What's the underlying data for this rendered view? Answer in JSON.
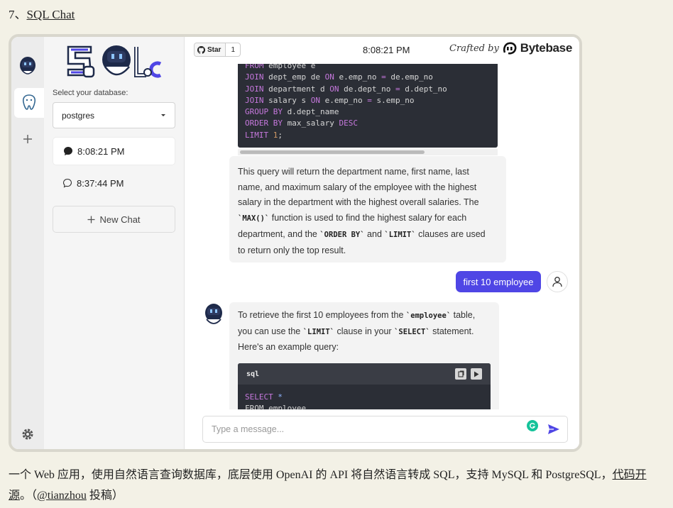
{
  "heading": {
    "number": "7、",
    "link": "SQL Chat"
  },
  "sidebar": {
    "db_label": "Select your database:",
    "db_selected": "postgres",
    "chats": [
      {
        "label": "8:08:21 PM",
        "active": true
      },
      {
        "label": "8:37:44 PM",
        "active": false
      }
    ],
    "new_chat": "New Chat"
  },
  "topbar": {
    "star_label": "Star",
    "star_count": "1",
    "clock": "8:08:21 PM",
    "crafted_by": "Crafted by",
    "brand": "Bytebase"
  },
  "code_top": [
    "FROM employee e",
    "JOIN dept_emp de ON e.emp_no = de.emp_no",
    "JOIN department d ON de.dept_no = d.dept_no",
    "JOIN salary s ON e.emp_no = s.emp_no",
    "GROUP BY d.dept_name",
    "ORDER BY max_salary DESC",
    "LIMIT 1;"
  ],
  "answer1": {
    "l1": "This query will return the department name, first name, last",
    "l2": "name, and maximum salary of the employee with the highest",
    "l3": "salary in the department with the highest overall salaries. The",
    "l4a": "`MAX()`",
    "l4b": " function is used to find the highest salary for each",
    "l5a": "department, and the ",
    "l5b": "`ORDER BY`",
    "l5c": " and ",
    "l5d": "`LIMIT`",
    "l5e": " clauses are used",
    "l6": "to return only the top result."
  },
  "user_message": "first 10 employee",
  "answer2": {
    "l1a": "To retrieve the first 10 employees from the ",
    "l1b": "`employee`",
    "l1c": " table,",
    "l2a": "you can use the ",
    "l2b": "`LIMIT`",
    "l2c": " clause in your ",
    "l2d": "`SELECT`",
    "l2e": " statement.",
    "l3": "Here's an example query:"
  },
  "code_block2": {
    "lang": "sql",
    "line1_kw": "SELECT",
    "line1_rest": " *",
    "line2": "FROM employee"
  },
  "input": {
    "placeholder": "Type a message..."
  },
  "caption": {
    "part1": "一个 Web 应用，使用自然语言查询数据库，底层使用 OpenAI 的 API 将自然语言转成 SQL，支持 MySQL 和 PostgreSQL，",
    "link1": "代码开源",
    "part2": "。（",
    "link2": "@tianzhou",
    "part3": " 投稿）"
  },
  "colors": {
    "accent": "#4f46e5",
    "code_bg": "#2b2e36",
    "page_bg": "#f3f1e6"
  },
  "icons": [
    "github-icon",
    "bytebase-logo",
    "chevron-down-icon",
    "chat-bubble-icon",
    "plus-icon",
    "gear-icon",
    "user-icon",
    "send-icon",
    "grammarly-icon",
    "copy-icon",
    "play-icon"
  ]
}
